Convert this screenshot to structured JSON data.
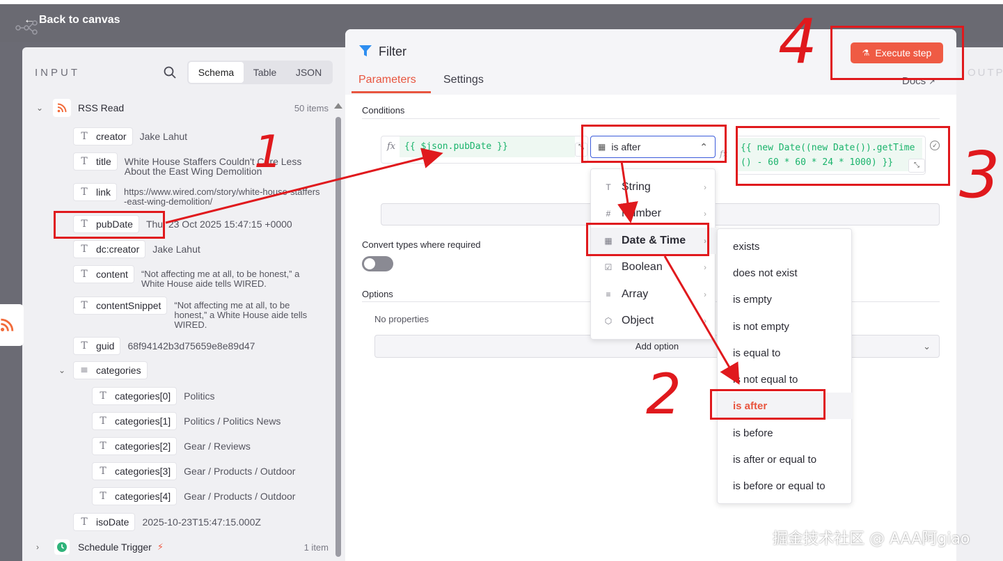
{
  "topbar": {
    "back_label": "Back to canvas"
  },
  "input": {
    "header": "INPUT",
    "view_tabs": [
      "Schema",
      "Table",
      "JSON"
    ],
    "active_tab": "Schema",
    "node": {
      "name": "RSS Read",
      "count": "50 items"
    },
    "fields": [
      {
        "key": "creator",
        "value": "Jake Lahut"
      },
      {
        "key": "title",
        "value": "White House Staffers Couldn't Care Less About the East Wing Demolition"
      },
      {
        "key": "link",
        "value": "https://www.wired.com/story/white-house-staffers-east-wing-demolition/"
      },
      {
        "key": "pubDate",
        "value": "Thu, 23 Oct 2025 15:47:15 +0000"
      },
      {
        "key": "dc:creator",
        "value": "Jake Lahut"
      },
      {
        "key": "content",
        "value": "“Not affecting me at all, to be honest,” a White House aide tells WIRED."
      },
      {
        "key": "contentSnippet",
        "value": "“Not affecting me at all, to be honest,” a White House aide tells WIRED."
      },
      {
        "key": "guid",
        "value": "68f94142b3d75659e8e89d47"
      }
    ],
    "categories": {
      "key": "categories",
      "items": [
        {
          "key": "categories[0]",
          "value": "Politics"
        },
        {
          "key": "categories[1]",
          "value": "Politics / Politics News"
        },
        {
          "key": "categories[2]",
          "value": "Gear / Reviews"
        },
        {
          "key": "categories[3]",
          "value": "Gear / Products / Outdoor"
        },
        {
          "key": "categories[4]",
          "value": "Gear / Products / Outdoor"
        }
      ]
    },
    "iso_date": {
      "key": "isoDate",
      "value": "2025-10-23T15:47:15.000Z"
    },
    "schedule": {
      "name": "Schedule Trigger",
      "count": "1 item"
    }
  },
  "filter": {
    "title": "Filter",
    "tabs": [
      "Parameters",
      "Settings"
    ],
    "docs": "Docs",
    "execute_label": "Execute step",
    "output_label": "OUTP",
    "conditions_label": "Conditions",
    "left_expr": "{{ $json.pubDate }}",
    "operator": "is after",
    "right_expr": "{{ new Date((new Date()).getTime() - 60 * 60 * 24 * 1000) }}",
    "convert_label": "Convert types where required",
    "convert_on": false,
    "options_label": "Options",
    "no_properties": "No properties",
    "add_option": "Add option"
  },
  "type_menu": [
    "String",
    "Number",
    "Date & Time",
    "Boolean",
    "Array",
    "Object"
  ],
  "type_menu_active": "Date & Time",
  "op_menu": [
    "exists",
    "does not exist",
    "is empty",
    "is not empty",
    "is equal to",
    "is not equal to",
    "is after",
    "is before",
    "is after or equal to",
    "is before or equal to"
  ],
  "op_selected": "is after",
  "annotations": {
    "n1": "1",
    "n2": "2",
    "n3": "3",
    "n4": "4"
  },
  "watermark": "掘金技术社区 @ AAA阿giao",
  "colors": {
    "accent": "#e8553f",
    "annotation": "#e0191d",
    "expression": "#19b36b"
  }
}
